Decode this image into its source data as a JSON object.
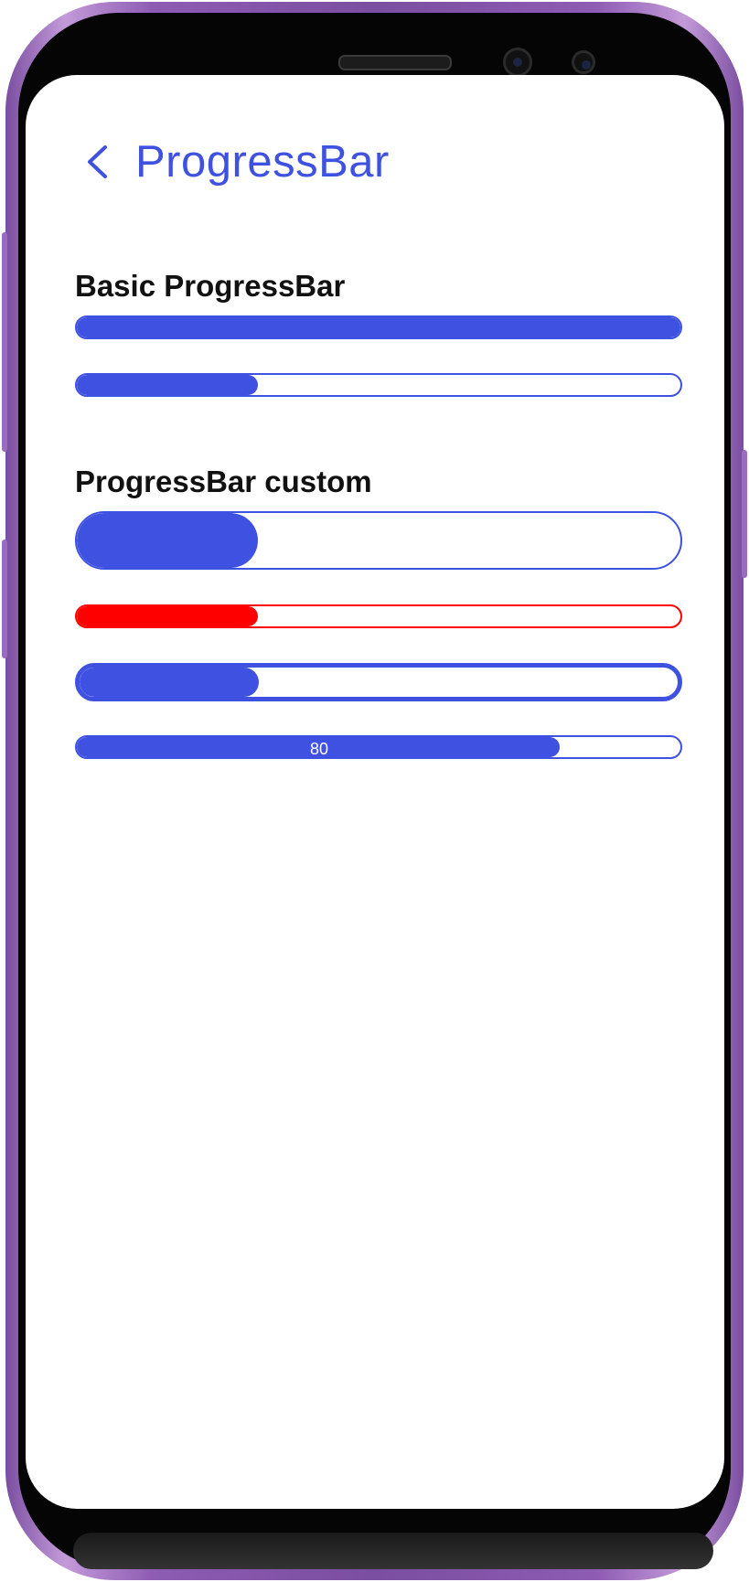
{
  "header": {
    "back_icon": "chevron-left-icon",
    "title": "ProgressBar"
  },
  "colors": {
    "accent": "#3f51e0",
    "danger": "#ff0000"
  },
  "sections": [
    {
      "title": "Basic ProgressBar",
      "bars": [
        {
          "progress": 100,
          "color": "#3f51e0"
        },
        {
          "progress": 30,
          "color": "#3f51e0"
        }
      ]
    },
    {
      "title": "ProgressBar custom",
      "bars": [
        {
          "progress": 30,
          "color": "#3f51e0"
        },
        {
          "progress": 30,
          "color": "#ff0000"
        },
        {
          "progress": 30,
          "color": "#3f51e0"
        },
        {
          "progress": 80,
          "color": "#3f51e0",
          "label": "80"
        }
      ]
    }
  ]
}
